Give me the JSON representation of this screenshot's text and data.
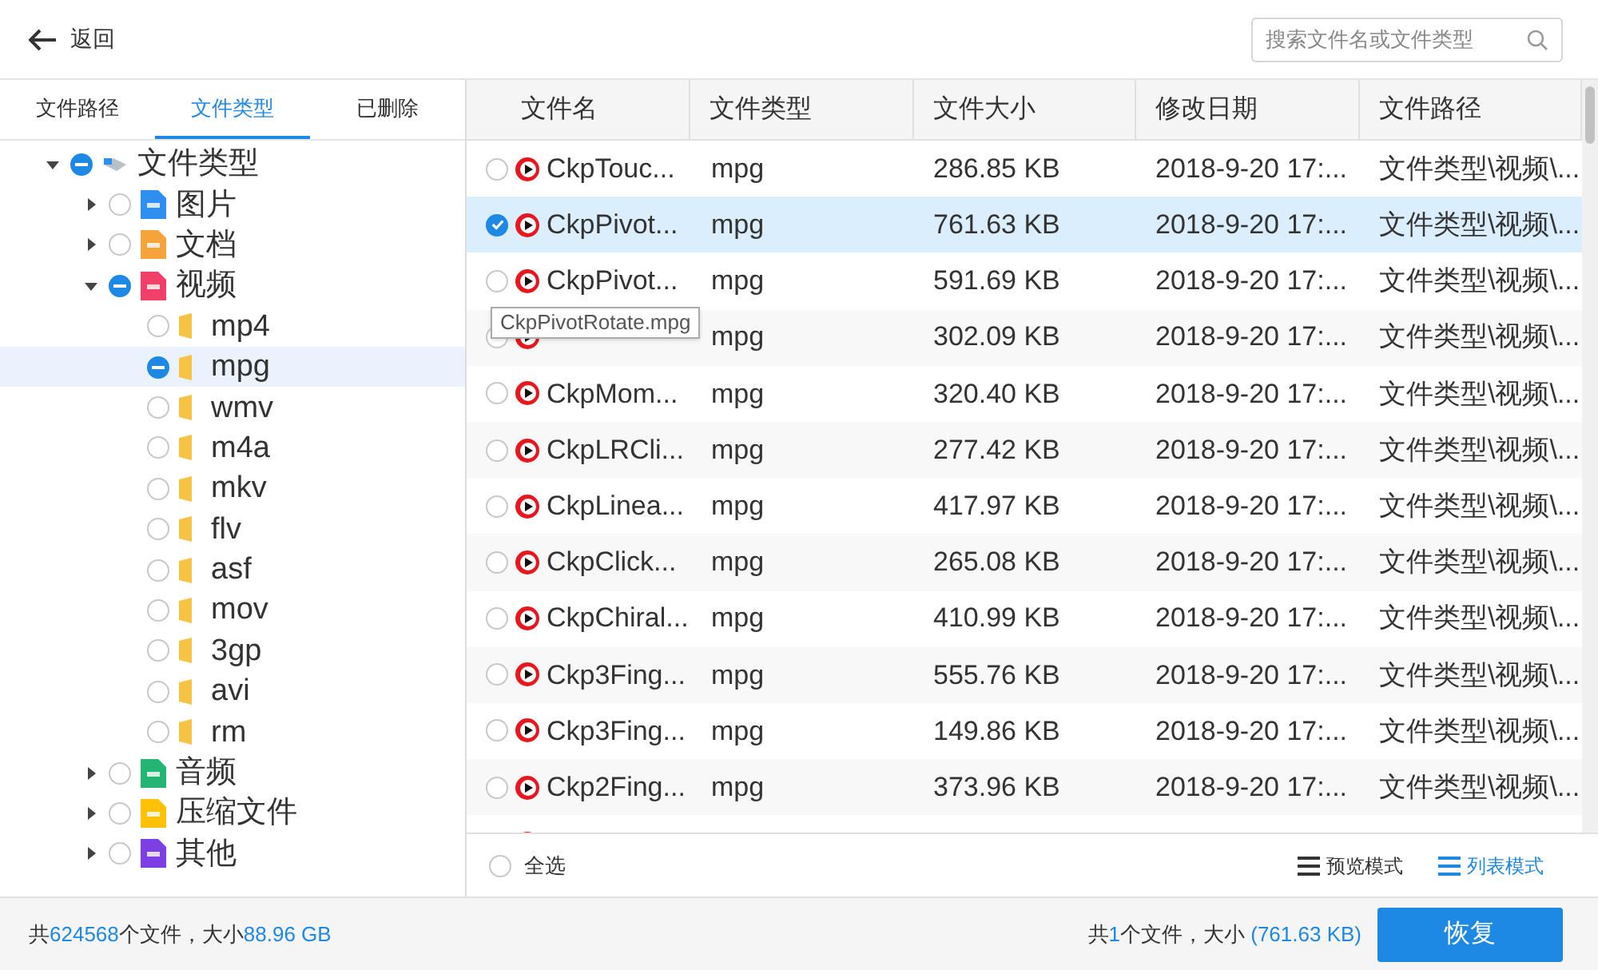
{
  "toolbar": {
    "back": "返回",
    "search": {
      "placeholder": "搜索文件名或文件类型"
    }
  },
  "sidebar": {
    "tabs": [
      {
        "label": "文件路径",
        "selected": false
      },
      {
        "label": "文件类型",
        "selected": true
      },
      {
        "label": "已删除",
        "selected": false
      }
    ],
    "tree": [
      {
        "label": "文件类型",
        "kind": "root",
        "expanded": true,
        "partial": true,
        "selected": false,
        "children": [
          {
            "label": "图片",
            "kind": "category",
            "color": "#2f8ff0",
            "expanded": false,
            "partial": false,
            "selected": false
          },
          {
            "label": "文档",
            "kind": "category",
            "color": "#f7a33b",
            "expanded": false,
            "partial": false,
            "selected": false
          },
          {
            "label": "视频",
            "kind": "category",
            "color": "#f0406a",
            "expanded": true,
            "partial": true,
            "selected": false,
            "children": [
              {
                "label": "mp4",
                "kind": "folder",
                "partial": false,
                "selected": false
              },
              {
                "label": "mpg",
                "kind": "folder",
                "partial": true,
                "selected": true
              },
              {
                "label": "wmv",
                "kind": "folder",
                "partial": false,
                "selected": false
              },
              {
                "label": "m4a",
                "kind": "folder",
                "partial": false,
                "selected": false
              },
              {
                "label": "mkv",
                "kind": "folder",
                "partial": false,
                "selected": false
              },
              {
                "label": "flv",
                "kind": "folder",
                "partial": false,
                "selected": false
              },
              {
                "label": "asf",
                "kind": "folder",
                "partial": false,
                "selected": false
              },
              {
                "label": "mov",
                "kind": "folder",
                "partial": false,
                "selected": false
              },
              {
                "label": "3gp",
                "kind": "folder",
                "partial": false,
                "selected": false
              },
              {
                "label": "avi",
                "kind": "folder",
                "partial": false,
                "selected": false
              },
              {
                "label": "rm",
                "kind": "folder",
                "partial": false,
                "selected": false
              }
            ]
          },
          {
            "label": "音频",
            "kind": "category",
            "color": "#22b573",
            "expanded": false,
            "partial": false,
            "selected": false
          },
          {
            "label": "压缩文件",
            "kind": "category",
            "color": "#ffc107",
            "expanded": false,
            "partial": false,
            "selected": false
          },
          {
            "label": "其他",
            "kind": "category",
            "color": "#7b3fe4",
            "expanded": false,
            "partial": false,
            "selected": false
          }
        ]
      }
    ]
  },
  "table": {
    "columns": [
      "文件名",
      "文件类型",
      "文件大小",
      "修改日期",
      "文件路径"
    ],
    "rows": [
      {
        "name": "CkpTouc...",
        "type": "mpg",
        "size": "286.85 KB",
        "date": "2018-9-20 17:...",
        "path": "文件类型\\视频\\...",
        "selected": false
      },
      {
        "name": "CkpPivot...",
        "type": "mpg",
        "size": "761.63 KB",
        "date": "2018-9-20 17:...",
        "path": "文件类型\\视频\\...",
        "selected": true
      },
      {
        "name": "CkpPivot...",
        "type": "mpg",
        "size": "591.69 KB",
        "date": "2018-9-20 17:...",
        "path": "文件类型\\视频\\...",
        "selected": false
      },
      {
        "type": "mpg",
        "size": "302.09 KB",
        "date": "2018-9-20 17:...",
        "path": "文件类型\\视频\\...",
        "selected": false
      },
      {
        "name": "CkpMom...",
        "type": "mpg",
        "size": "320.40 KB",
        "date": "2018-9-20 17:...",
        "path": "文件类型\\视频\\...",
        "selected": false
      },
      {
        "name": "CkpLRCli...",
        "type": "mpg",
        "size": "277.42 KB",
        "date": "2018-9-20 17:...",
        "path": "文件类型\\视频\\...",
        "selected": false
      },
      {
        "name": "CkpLinea...",
        "type": "mpg",
        "size": "417.97 KB",
        "date": "2018-9-20 17:...",
        "path": "文件类型\\视频\\...",
        "selected": false
      },
      {
        "name": "CkpClick...",
        "type": "mpg",
        "size": "265.08 KB",
        "date": "2018-9-20 17:...",
        "path": "文件类型\\视频\\...",
        "selected": false
      },
      {
        "name": "CkpChiral...",
        "type": "mpg",
        "size": "410.99 KB",
        "date": "2018-9-20 17:...",
        "path": "文件类型\\视频\\...",
        "selected": false
      },
      {
        "name": "Ckp3Fing...",
        "type": "mpg",
        "size": "555.76 KB",
        "date": "2018-9-20 17:...",
        "path": "文件类型\\视频\\...",
        "selected": false
      },
      {
        "name": "Ckp3Fing...",
        "type": "mpg",
        "size": "149.86 KB",
        "date": "2018-9-20 17:...",
        "path": "文件类型\\视频\\...",
        "selected": false
      },
      {
        "name": "Ckp2Fing...",
        "type": "mpg",
        "size": "373.96 KB",
        "date": "2018-9-20 17:...",
        "path": "文件类型\\视频\\...",
        "selected": false
      }
    ],
    "tooltip": "CkpPivotRotate.mpg",
    "select_all": {
      "label": "全选",
      "checked": false
    },
    "view_modes": [
      {
        "label": "预览模式",
        "selected": false
      },
      {
        "label": "列表模式",
        "selected": true
      }
    ]
  },
  "status_bar": {
    "total_prefix": "共",
    "total_count": "624568",
    "total_mid": "个文件，大小",
    "total_size": "88.96 GB",
    "sel_prefix": "共",
    "sel_count": "1",
    "sel_mid": "个文件，大小",
    "sel_size": "(761.63 KB)",
    "restore": "恢复"
  }
}
